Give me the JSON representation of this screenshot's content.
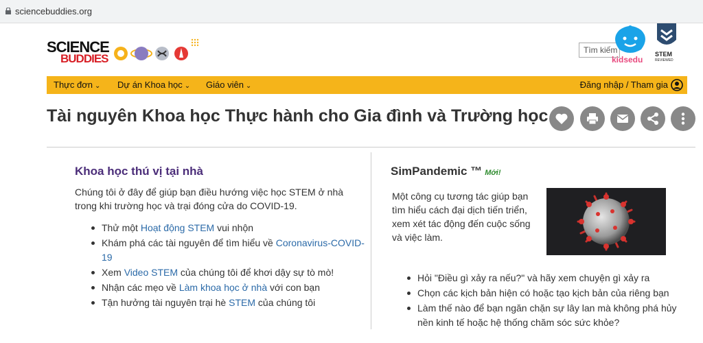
{
  "browser": {
    "url": "sciencebuddies.org"
  },
  "header": {
    "logo_line1": "SCIENCE",
    "logo_line2": "BUDDIES",
    "search_placeholder": "Tìm kiếm",
    "kidsedu_label": "kidsedu",
    "stem_badge_line1": "STEM",
    "stem_badge_line2": "REVIEWED"
  },
  "nav": {
    "items": [
      "Thực đơn",
      "Dự án Khoa học",
      "Giáo viên"
    ],
    "login": "Đăng nhập / Tham gia"
  },
  "page": {
    "title": "Tài nguyên Khoa học Thực hành cho Gia đình và Trường học"
  },
  "left": {
    "heading": "Khoa học thú vị tại nhà",
    "intro": "Chúng tôi ở đây để giúp bạn điều hướng việc học STEM ở nhà trong khi trường học và trại đóng cửa do COVID-19.",
    "list": [
      {
        "pre": "Thử một ",
        "link": "Hoạt động STEM",
        "post": " vui nhộn"
      },
      {
        "pre": "Khám phá các tài nguyên để tìm hiểu về ",
        "link": "Coronavirus-COVID-19",
        "post": ""
      },
      {
        "pre": "Xem ",
        "link": "Video STEM",
        "post": " của chúng tôi để khơi dậy sự tò mò!"
      },
      {
        "pre": "Nhận các mẹo về ",
        "link": "Làm khoa học ở nhà",
        "post": " với con bạn"
      },
      {
        "pre": "Tận hưởng tài nguyên trại hè ",
        "link": "STEM",
        "post": " của chúng tôi"
      }
    ]
  },
  "right": {
    "heading": "SimPandemic ™",
    "new_badge": "Mới!",
    "intro": "Một công cụ tương tác giúp bạn tìm hiểu cách đại dịch tiến triển, xem xét tác động đến cuộc sống và việc làm.",
    "list": [
      "Hỏi \"Điều gì xảy ra nếu?\" và hãy xem chuyện gì xảy ra",
      "Chọn các kịch bản hiện có hoặc tạo kịch bản của riêng bạn",
      "Làm thế nào để bạn ngăn chặn sự lây lan mà không phá hủy nền kinh tế hoặc hệ thống chăm sóc sức khỏe?"
    ]
  },
  "colors": {
    "nav_bar": "#f5b41a",
    "left_heading": "#4b2d79",
    "link": "#2b6aa8",
    "new_badge": "#2e8b2e",
    "share_buttons": "#888888"
  },
  "icons": [
    "lock-icon",
    "heart-icon",
    "print-icon",
    "mail-icon",
    "share-icon",
    "more-icon",
    "user-icon"
  ]
}
